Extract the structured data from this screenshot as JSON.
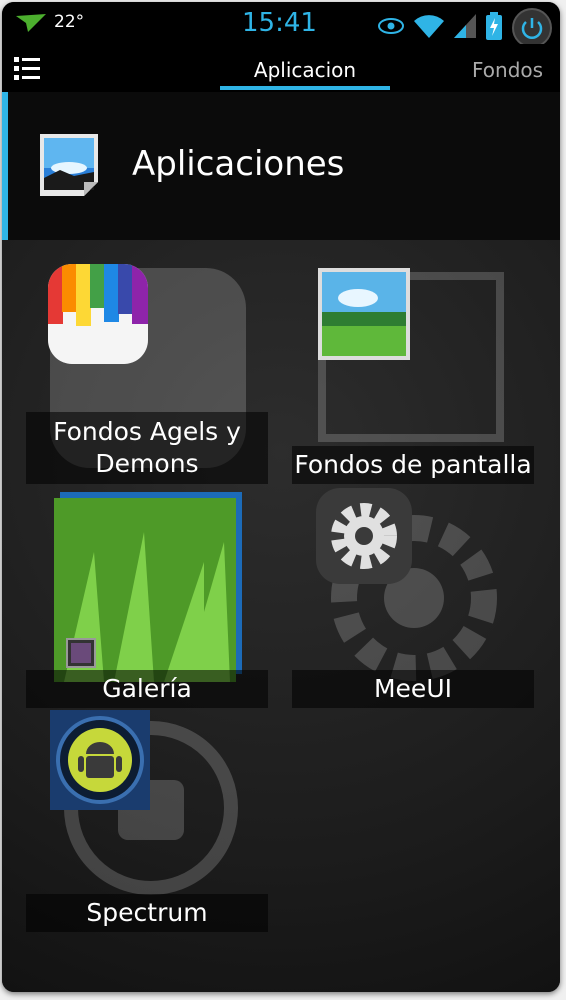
{
  "status_bar": {
    "temperature": "22°",
    "time": "15:41",
    "icons": [
      "notification-arrow-icon",
      "eye-icon",
      "wifi-icon",
      "signal-icon",
      "battery-charging-icon",
      "power-icon"
    ]
  },
  "action_bar": {
    "tabs": [
      {
        "label": "Aplicacion",
        "active": true
      },
      {
        "label": "Fondos",
        "active": false
      }
    ]
  },
  "header": {
    "title": "Aplicaciones"
  },
  "apps": [
    {
      "label": "Fondos Agels y Demons"
    },
    {
      "label": "Fondos de pantalla"
    },
    {
      "label": "Galería"
    },
    {
      "label": "MeeUI"
    },
    {
      "label": "Spectrum"
    }
  ],
  "colors": {
    "accent": "#2fb4e6",
    "background": "#1b1b1b"
  }
}
